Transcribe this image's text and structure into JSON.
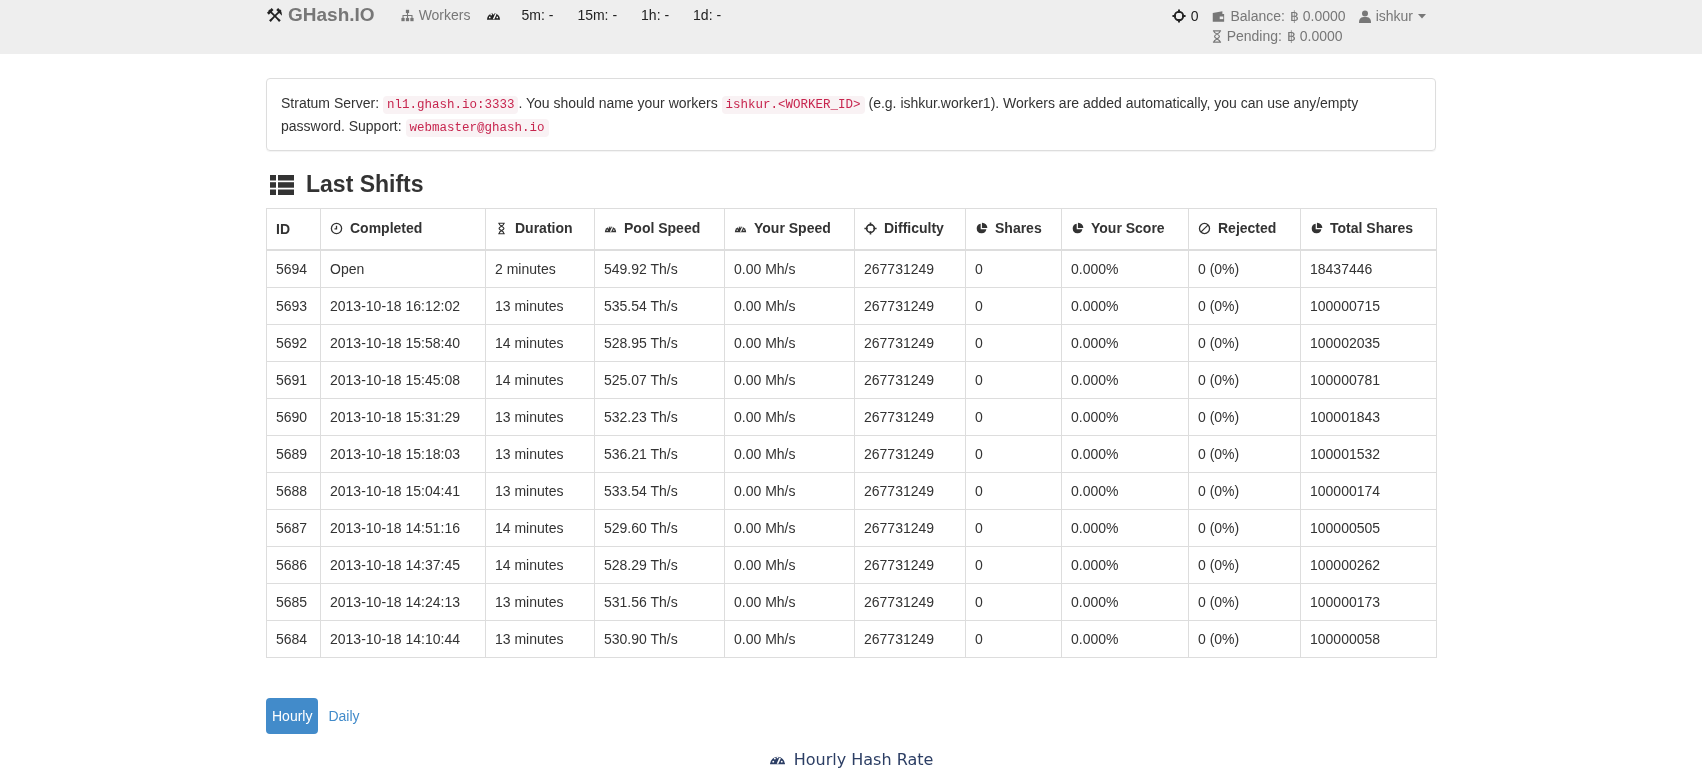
{
  "navbar": {
    "brand_icon": "⚒",
    "brand": "GHash.IO",
    "workers_link": "Workers",
    "rates": [
      "5m: -",
      "15m: -",
      "1h: -",
      "1d: -"
    ],
    "difficulty_count": "0",
    "balance_label": "Balance:",
    "balance_value": "฿ 0.0000",
    "user": "ishkur",
    "pending_label": "Pending:",
    "pending_value": "฿ 0.0000"
  },
  "info": {
    "segments": [
      {
        "kind": "text",
        "text": "Stratum Server: "
      },
      {
        "kind": "code",
        "text": "nl1.ghash.io:3333"
      },
      {
        "kind": "text",
        "text": ". You should name your workers "
      },
      {
        "kind": "code",
        "text": "ishkur.<WORKER_ID>"
      },
      {
        "kind": "text",
        "text": " (e.g. ishkur.worker1). Workers are added automatically, you can use any/empty password. Support: "
      },
      {
        "kind": "code",
        "text": "webmaster@ghash.io"
      }
    ]
  },
  "section_title": "Last Shifts",
  "table": {
    "columns": [
      "ID",
      "Completed",
      "Duration",
      "Pool Speed",
      "Your Speed",
      "Difficulty",
      "Shares",
      "Your Score",
      "Rejected",
      "Total Shares"
    ],
    "rows": [
      [
        "5694",
        "Open",
        "2 minutes",
        "549.92 Th/s",
        "0.00 Mh/s",
        "267731249",
        "0",
        "0.000%",
        "0 (0%)",
        "18437446"
      ],
      [
        "5693",
        "2013-10-18 16:12:02",
        "13 minutes",
        "535.54 Th/s",
        "0.00 Mh/s",
        "267731249",
        "0",
        "0.000%",
        "0 (0%)",
        "100000715"
      ],
      [
        "5692",
        "2013-10-18 15:58:40",
        "14 minutes",
        "528.95 Th/s",
        "0.00 Mh/s",
        "267731249",
        "0",
        "0.000%",
        "0 (0%)",
        "100002035"
      ],
      [
        "5691",
        "2013-10-18 15:45:08",
        "14 minutes",
        "525.07 Th/s",
        "0.00 Mh/s",
        "267731249",
        "0",
        "0.000%",
        "0 (0%)",
        "100000781"
      ],
      [
        "5690",
        "2013-10-18 15:31:29",
        "13 minutes",
        "532.23 Th/s",
        "0.00 Mh/s",
        "267731249",
        "0",
        "0.000%",
        "0 (0%)",
        "100001843"
      ],
      [
        "5689",
        "2013-10-18 15:18:03",
        "13 minutes",
        "536.21 Th/s",
        "0.00 Mh/s",
        "267731249",
        "0",
        "0.000%",
        "0 (0%)",
        "100001532"
      ],
      [
        "5688",
        "2013-10-18 15:04:41",
        "13 minutes",
        "533.54 Th/s",
        "0.00 Mh/s",
        "267731249",
        "0",
        "0.000%",
        "0 (0%)",
        "100000174"
      ],
      [
        "5687",
        "2013-10-18 14:51:16",
        "14 minutes",
        "529.60 Th/s",
        "0.00 Mh/s",
        "267731249",
        "0",
        "0.000%",
        "0 (0%)",
        "100000505"
      ],
      [
        "5686",
        "2013-10-18 14:37:45",
        "14 minutes",
        "528.29 Th/s",
        "0.00 Mh/s",
        "267731249",
        "0",
        "0.000%",
        "0 (0%)",
        "100000262"
      ],
      [
        "5685",
        "2013-10-18 14:24:13",
        "13 minutes",
        "531.56 Th/s",
        "0.00 Mh/s",
        "267731249",
        "0",
        "0.000%",
        "0 (0%)",
        "100000173"
      ],
      [
        "5684",
        "2013-10-18 14:10:44",
        "13 minutes",
        "530.90 Th/s",
        "0.00 Mh/s",
        "267731249",
        "0",
        "0.000%",
        "0 (0%)",
        "100000058"
      ]
    ]
  },
  "chart_tabs": [
    {
      "label": "Hourly",
      "selected": true
    },
    {
      "label": "Daily",
      "selected": false
    }
  ],
  "chart_title": "Hourly Hash Rate"
}
